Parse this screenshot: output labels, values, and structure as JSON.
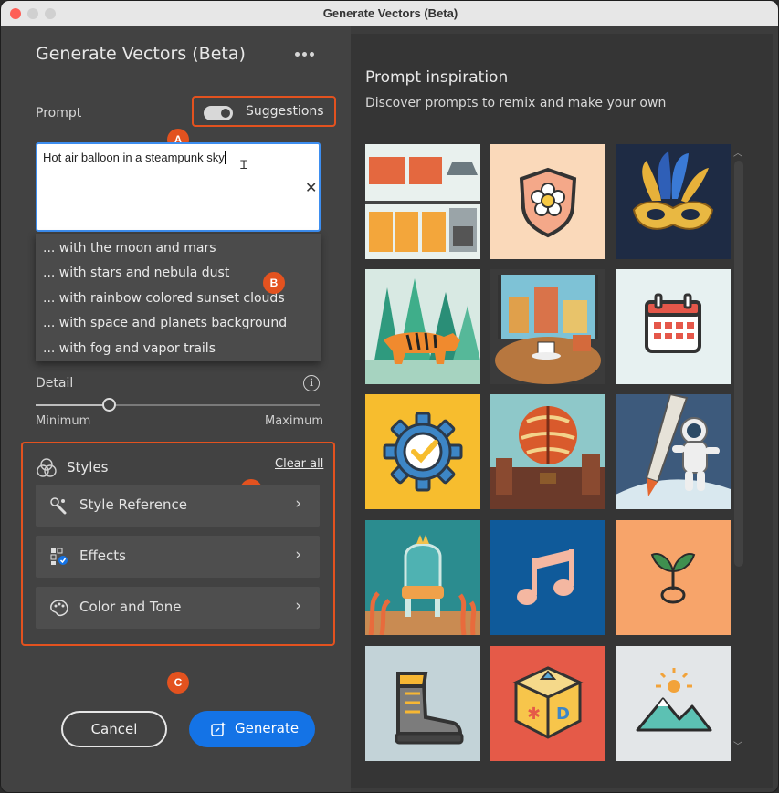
{
  "window": {
    "title": "Generate Vectors (Beta)"
  },
  "panel": {
    "title": "Generate Vectors (Beta)",
    "more_icon": "more-horizontal-icon",
    "prompt_label": "Prompt",
    "suggestions_toggle": {
      "label": "Suggestions",
      "on": true
    },
    "prompt_value": "Hot air balloon in a steampunk sky",
    "suggestions": [
      "... with the moon and mars",
      "... with stars and nebula dust",
      "... with rainbow colored sunset clouds",
      "... with space and planets background",
      "... with fog and vapor trails"
    ],
    "detail": {
      "label": "Detail",
      "min_label": "Minimum",
      "max_label": "Maximum",
      "value_fraction": 0.26
    },
    "styles": {
      "label": "Styles",
      "clear_all": "Clear all",
      "items": [
        {
          "label": "Style Reference",
          "icon": "style-reference-icon"
        },
        {
          "label": "Effects",
          "icon": "effects-icon"
        },
        {
          "label": "Color and Tone",
          "icon": "palette-icon"
        }
      ]
    },
    "cancel_label": "Cancel",
    "generate_label": "Generate"
  },
  "annotations": {
    "a": "A",
    "b": "B",
    "c": "C",
    "d": "D",
    "color": "#e3521f"
  },
  "inspiration": {
    "title": "Prompt inspiration",
    "subtitle": "Discover prompts to remix and make your own",
    "tiles": [
      "kitchen-illustration",
      "flower-shield-icon",
      "carnival-mask-illustration",
      "tiger-forest-illustration",
      "cafe-table-illustration",
      "calendar-icon",
      "gear-check-icon",
      "hot-air-balloon-illustration",
      "astronaut-rocket-illustration",
      "underwater-throne-illustration",
      "music-note-icon",
      "sprout-icon",
      "boot-icon",
      "toy-block-icon",
      "mountain-sun-icon"
    ]
  },
  "colors": {
    "accent": "#1473e6",
    "focus": "#3d8ef0"
  }
}
